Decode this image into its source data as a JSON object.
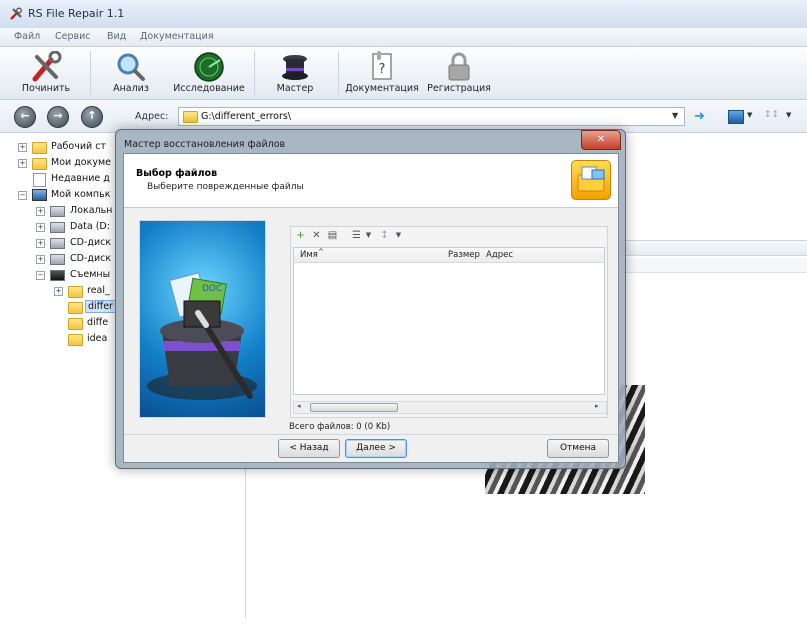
{
  "window": {
    "title": "RS File Repair 1.1"
  },
  "menu": {
    "items": [
      "Файл",
      "Сервис",
      "Вид",
      "Документация"
    ]
  },
  "toolbar": {
    "buttons": [
      {
        "label": "Починить",
        "icon": "wrench-screwdriver-icon"
      },
      {
        "label": "Анализ",
        "icon": "magnifier-icon"
      },
      {
        "label": "Исследование",
        "icon": "radar-icon"
      },
      {
        "label": "Мастер",
        "icon": "magic-hat-icon"
      },
      {
        "label": "Документация",
        "icon": "document-help-icon"
      },
      {
        "label": "Регистрация",
        "icon": "lock-icon"
      }
    ]
  },
  "address": {
    "label": "Адрес:",
    "value": "G:\\different_errors\\"
  },
  "tree": {
    "items": [
      {
        "label": "Рабочий ст",
        "kind": "folder"
      },
      {
        "label": "Мои докуме",
        "kind": "folder"
      },
      {
        "label": "Недавние д",
        "kind": "recent"
      },
      {
        "label": "Мой компьк",
        "kind": "computer"
      },
      {
        "label": "Локальн",
        "kind": "drive"
      },
      {
        "label": "Data (D:",
        "kind": "drive"
      },
      {
        "label": "CD-диск",
        "kind": "cd"
      },
      {
        "label": "CD-диск",
        "kind": "cd"
      },
      {
        "label": "Съемны",
        "kind": "removable"
      },
      {
        "label": "real_",
        "kind": "folder"
      },
      {
        "label": "differ",
        "kind": "folder"
      },
      {
        "label": "diffe",
        "kind": "folder"
      },
      {
        "label": "idea",
        "kind": "folder"
      }
    ]
  },
  "dialog": {
    "title": "Мастер восстановления файлов",
    "close": "✕",
    "heading": "Выбор файлов",
    "subheading": "Выберите поврежденные файлы",
    "columns": [
      "Имя",
      "Размер",
      "Адрес"
    ],
    "total": "Всего файлов: 0 (0 Kb)",
    "buttons": {
      "back": "< Назад",
      "next": "Далее >",
      "cancel": "Отмена"
    }
  }
}
